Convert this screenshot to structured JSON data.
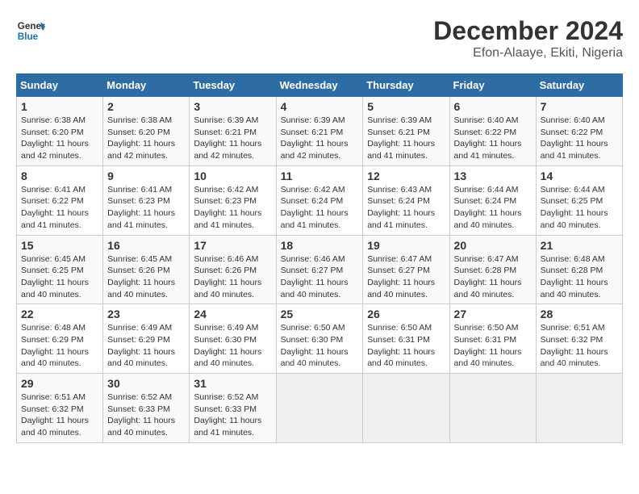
{
  "header": {
    "logo_line1": "General",
    "logo_line2": "Blue",
    "month": "December 2024",
    "location": "Efon-Alaaye, Ekiti, Nigeria"
  },
  "days_of_week": [
    "Sunday",
    "Monday",
    "Tuesday",
    "Wednesday",
    "Thursday",
    "Friday",
    "Saturday"
  ],
  "weeks": [
    [
      {
        "day": "1",
        "sunrise": "6:38 AM",
        "sunset": "6:20 PM",
        "daylight": "11 hours and 42 minutes."
      },
      {
        "day": "2",
        "sunrise": "6:38 AM",
        "sunset": "6:20 PM",
        "daylight": "11 hours and 42 minutes."
      },
      {
        "day": "3",
        "sunrise": "6:39 AM",
        "sunset": "6:21 PM",
        "daylight": "11 hours and 42 minutes."
      },
      {
        "day": "4",
        "sunrise": "6:39 AM",
        "sunset": "6:21 PM",
        "daylight": "11 hours and 42 minutes."
      },
      {
        "day": "5",
        "sunrise": "6:39 AM",
        "sunset": "6:21 PM",
        "daylight": "11 hours and 41 minutes."
      },
      {
        "day": "6",
        "sunrise": "6:40 AM",
        "sunset": "6:22 PM",
        "daylight": "11 hours and 41 minutes."
      },
      {
        "day": "7",
        "sunrise": "6:40 AM",
        "sunset": "6:22 PM",
        "daylight": "11 hours and 41 minutes."
      }
    ],
    [
      {
        "day": "8",
        "sunrise": "6:41 AM",
        "sunset": "6:22 PM",
        "daylight": "11 hours and 41 minutes."
      },
      {
        "day": "9",
        "sunrise": "6:41 AM",
        "sunset": "6:23 PM",
        "daylight": "11 hours and 41 minutes."
      },
      {
        "day": "10",
        "sunrise": "6:42 AM",
        "sunset": "6:23 PM",
        "daylight": "11 hours and 41 minutes."
      },
      {
        "day": "11",
        "sunrise": "6:42 AM",
        "sunset": "6:24 PM",
        "daylight": "11 hours and 41 minutes."
      },
      {
        "day": "12",
        "sunrise": "6:43 AM",
        "sunset": "6:24 PM",
        "daylight": "11 hours and 41 minutes."
      },
      {
        "day": "13",
        "sunrise": "6:44 AM",
        "sunset": "6:24 PM",
        "daylight": "11 hours and 40 minutes."
      },
      {
        "day": "14",
        "sunrise": "6:44 AM",
        "sunset": "6:25 PM",
        "daylight": "11 hours and 40 minutes."
      }
    ],
    [
      {
        "day": "15",
        "sunrise": "6:45 AM",
        "sunset": "6:25 PM",
        "daylight": "11 hours and 40 minutes."
      },
      {
        "day": "16",
        "sunrise": "6:45 AM",
        "sunset": "6:26 PM",
        "daylight": "11 hours and 40 minutes."
      },
      {
        "day": "17",
        "sunrise": "6:46 AM",
        "sunset": "6:26 PM",
        "daylight": "11 hours and 40 minutes."
      },
      {
        "day": "18",
        "sunrise": "6:46 AM",
        "sunset": "6:27 PM",
        "daylight": "11 hours and 40 minutes."
      },
      {
        "day": "19",
        "sunrise": "6:47 AM",
        "sunset": "6:27 PM",
        "daylight": "11 hours and 40 minutes."
      },
      {
        "day": "20",
        "sunrise": "6:47 AM",
        "sunset": "6:28 PM",
        "daylight": "11 hours and 40 minutes."
      },
      {
        "day": "21",
        "sunrise": "6:48 AM",
        "sunset": "6:28 PM",
        "daylight": "11 hours and 40 minutes."
      }
    ],
    [
      {
        "day": "22",
        "sunrise": "6:48 AM",
        "sunset": "6:29 PM",
        "daylight": "11 hours and 40 minutes."
      },
      {
        "day": "23",
        "sunrise": "6:49 AM",
        "sunset": "6:29 PM",
        "daylight": "11 hours and 40 minutes."
      },
      {
        "day": "24",
        "sunrise": "6:49 AM",
        "sunset": "6:30 PM",
        "daylight": "11 hours and 40 minutes."
      },
      {
        "day": "25",
        "sunrise": "6:50 AM",
        "sunset": "6:30 PM",
        "daylight": "11 hours and 40 minutes."
      },
      {
        "day": "26",
        "sunrise": "6:50 AM",
        "sunset": "6:31 PM",
        "daylight": "11 hours and 40 minutes."
      },
      {
        "day": "27",
        "sunrise": "6:50 AM",
        "sunset": "6:31 PM",
        "daylight": "11 hours and 40 minutes."
      },
      {
        "day": "28",
        "sunrise": "6:51 AM",
        "sunset": "6:32 PM",
        "daylight": "11 hours and 40 minutes."
      }
    ],
    [
      {
        "day": "29",
        "sunrise": "6:51 AM",
        "sunset": "6:32 PM",
        "daylight": "11 hours and 40 minutes."
      },
      {
        "day": "30",
        "sunrise": "6:52 AM",
        "sunset": "6:33 PM",
        "daylight": "11 hours and 40 minutes."
      },
      {
        "day": "31",
        "sunrise": "6:52 AM",
        "sunset": "6:33 PM",
        "daylight": "11 hours and 41 minutes."
      },
      null,
      null,
      null,
      null
    ]
  ]
}
